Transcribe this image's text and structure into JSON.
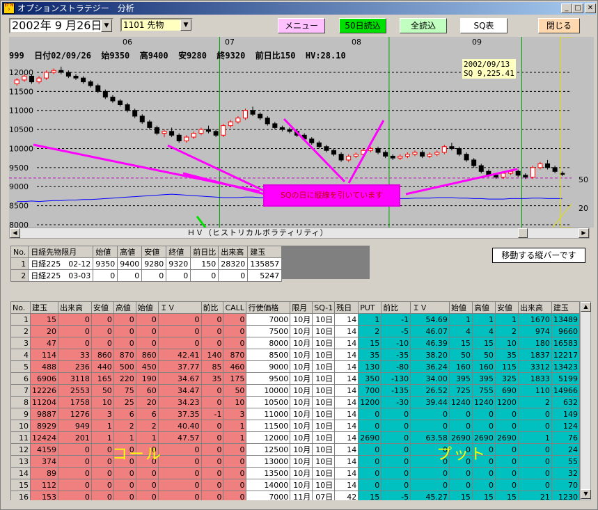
{
  "window": {
    "title": "オプションストラテジー　分析",
    "icon_text": "ｵﾌﾟｼｮﾝ",
    "min_label": "_",
    "max_label": "□",
    "close_label": "✕"
  },
  "toolbar": {
    "date": "2002年 9 月26日",
    "code": "1101 先物",
    "menu_label": "メニュー",
    "read50_label": "50日読込",
    "readall_label": "全読込",
    "sq_label": "SQ表",
    "close_label": "閉じる"
  },
  "chart": {
    "month_labels": [
      "06",
      "07",
      "08",
      "09"
    ],
    "info_line": "999  日付02/09/26  始9350  高9400  安9280  終9320  前日比150  HV:28.10",
    "sq_note_line1": "2002/09/13",
    "sq_note_line2": "SQ 9,225.41",
    "y_ticks": [
      "12000",
      "11500",
      "11000",
      "10500",
      "10000",
      "9500",
      "9000",
      "8500",
      "8000"
    ],
    "right_ticks": [
      "50",
      "20"
    ],
    "annotation": "SQの日に縦線を引いています",
    "hv_label": "ＨＶ（ヒストリカルボラティリティ）",
    "moving_bar_note": "移動する縦バーです",
    "colors": {
      "up": "#ff0000",
      "down": "#000000",
      "ma": "#0000ff",
      "sq_line": "#00a000",
      "annotation_bg": "#ff00ff",
      "annotation_arrow": "#ff00ff"
    }
  },
  "chart_data": {
    "type": "candlestick",
    "y_range": [
      8000,
      12200
    ],
    "hv_range": [
      0,
      100
    ],
    "sq_days": [
      28,
      51,
      69,
      93
    ],
    "candles": [
      [
        11700,
        11850,
        11650,
        11800
      ],
      [
        11800,
        11950,
        11750,
        11900
      ],
      [
        11900,
        11950,
        11700,
        11750
      ],
      [
        11750,
        11900,
        11700,
        11850
      ],
      [
        11850,
        12050,
        11800,
        12000
      ],
      [
        12000,
        12100,
        11950,
        12050
      ],
      [
        12050,
        12150,
        11950,
        12000
      ],
      [
        12000,
        12050,
        11850,
        11900
      ],
      [
        11900,
        11950,
        11800,
        11850
      ],
      [
        11850,
        11900,
        11700,
        11750
      ],
      [
        11750,
        11800,
        11600,
        11650
      ],
      [
        11650,
        11700,
        11450,
        11500
      ],
      [
        11500,
        11550,
        11300,
        11350
      ],
      [
        11350,
        11400,
        11200,
        11250
      ],
      [
        11250,
        11300,
        11100,
        11150
      ],
      [
        11150,
        11200,
        10950,
        11000
      ],
      [
        11000,
        11050,
        10800,
        10850
      ],
      [
        10850,
        10900,
        10650,
        10700
      ],
      [
        10700,
        10750,
        10500,
        10550
      ],
      [
        10550,
        10600,
        10350,
        10400
      ],
      [
        10400,
        10500,
        10300,
        10450
      ],
      [
        10450,
        10550,
        10300,
        10350
      ],
      [
        10350,
        10400,
        10150,
        10200
      ],
      [
        10200,
        10350,
        10150,
        10300
      ],
      [
        10300,
        10450,
        10250,
        10400
      ],
      [
        10400,
        10550,
        10350,
        10500
      ],
      [
        10500,
        10600,
        10400,
        10450
      ],
      [
        10450,
        10500,
        10300,
        10350
      ],
      [
        10350,
        10650,
        10300,
        10600
      ],
      [
        10600,
        10750,
        10550,
        10700
      ],
      [
        10700,
        10850,
        10650,
        10800
      ],
      [
        10800,
        11050,
        10750,
        11000
      ],
      [
        11000,
        11100,
        10850,
        10900
      ],
      [
        10900,
        10950,
        10750,
        10800
      ],
      [
        10800,
        10850,
        10600,
        10650
      ],
      [
        10650,
        10700,
        10500,
        10550
      ],
      [
        10550,
        10600,
        10450,
        10500
      ],
      [
        10500,
        10550,
        10400,
        10450
      ],
      [
        10450,
        10500,
        10300,
        10350
      ],
      [
        10350,
        10400,
        10200,
        10250
      ],
      [
        10250,
        10300,
        10100,
        10150
      ],
      [
        10150,
        10200,
        10000,
        10050
      ],
      [
        10050,
        10100,
        9900,
        9950
      ],
      [
        9950,
        10000,
        9800,
        9850
      ],
      [
        9850,
        9900,
        9650,
        9700
      ],
      [
        9700,
        9850,
        9650,
        9800
      ],
      [
        9800,
        9900,
        9750,
        9850
      ],
      [
        9850,
        10000,
        9800,
        9950
      ],
      [
        9950,
        10050,
        9900,
        10000
      ],
      [
        10000,
        10050,
        9850,
        9900
      ],
      [
        9900,
        9950,
        9750,
        9800
      ],
      [
        9800,
        9850,
        9700,
        9750
      ],
      [
        9750,
        9850,
        9700,
        9800
      ],
      [
        9800,
        9900,
        9750,
        9850
      ],
      [
        9850,
        9950,
        9800,
        9900
      ],
      [
        9900,
        9950,
        9750,
        9800
      ],
      [
        9800,
        9900,
        9750,
        9850
      ],
      [
        9850,
        9950,
        9800,
        9900
      ],
      [
        9900,
        10100,
        9850,
        10050
      ],
      [
        10050,
        10150,
        9950,
        10000
      ],
      [
        10000,
        10050,
        9800,
        9850
      ],
      [
        9850,
        9900,
        9650,
        9700
      ],
      [
        9700,
        9750,
        9500,
        9550
      ],
      [
        9550,
        9600,
        9350,
        9400
      ],
      [
        9400,
        9450,
        9250,
        9300
      ],
      [
        9300,
        9350,
        9200,
        9250
      ],
      [
        9250,
        9400,
        9200,
        9350
      ],
      [
        9350,
        9450,
        9300,
        9400
      ],
      [
        9400,
        9450,
        9250,
        9300
      ],
      [
        9300,
        9350,
        9200,
        9250
      ],
      [
        9250,
        9550,
        9200,
        9500
      ],
      [
        9500,
        9650,
        9450,
        9600
      ],
      [
        9600,
        9700,
        9450,
        9500
      ],
      [
        9500,
        9550,
        9350,
        9400
      ],
      [
        9350,
        9400,
        9280,
        9320
      ]
    ],
    "hv_series": [
      22,
      22,
      23,
      22,
      23,
      24,
      24,
      25,
      25,
      26,
      26,
      27,
      28,
      29,
      30,
      31,
      32,
      33,
      34,
      35,
      36,
      37,
      36,
      35,
      34,
      33,
      32,
      31,
      30,
      30,
      30,
      31,
      31,
      30,
      30,
      29,
      29,
      29,
      28,
      28,
      27,
      27,
      26,
      26,
      25,
      25,
      25,
      26,
      26,
      27,
      27,
      28,
      28,
      28,
      29,
      29,
      29,
      30,
      30,
      30,
      29,
      29,
      28,
      28,
      27,
      27,
      27,
      28,
      28,
      28,
      29,
      29,
      28,
      28,
      28
    ]
  },
  "futures": {
    "headers": [
      "No.",
      "日経先物限月",
      "始値",
      "高値",
      "安値",
      "終値",
      "前日比",
      "出来高",
      "建玉"
    ],
    "rows": [
      [
        "1",
        "日経225　02-12",
        "9350",
        "9400",
        "9280",
        "9320",
        "150",
        "28320",
        "135857"
      ],
      [
        "2",
        "日経225　03-03",
        "0",
        "0",
        "0",
        "0",
        "0",
        "0",
        "5247"
      ]
    ]
  },
  "options": {
    "headers": [
      "No.",
      "建玉",
      "出来高",
      "安値",
      "高値",
      "始値",
      "ＩＶ",
      "前比",
      "CALL",
      "行使価格",
      "限月",
      "SQ-1",
      "残日",
      "PUT",
      "前比",
      "ＩＶ",
      "始値",
      "高値",
      "安値",
      "出来高",
      "建玉"
    ],
    "rows": [
      [
        "1",
        "15",
        "0",
        "0",
        "0",
        "0",
        "0",
        "0",
        "0",
        "7000",
        "10月",
        "10日",
        "14",
        "1",
        "-1",
        "54.69",
        "1",
        "1",
        "1",
        "1670",
        "13489"
      ],
      [
        "2",
        "20",
        "0",
        "0",
        "0",
        "0",
        "0",
        "0",
        "0",
        "7500",
        "10月",
        "10日",
        "14",
        "2",
        "-5",
        "46.07",
        "4",
        "4",
        "2",
        "974",
        "9660"
      ],
      [
        "3",
        "47",
        "0",
        "0",
        "0",
        "0",
        "0",
        "0",
        "0",
        "8000",
        "10月",
        "10日",
        "14",
        "15",
        "-10",
        "46.39",
        "15",
        "15",
        "10",
        "180",
        "16583"
      ],
      [
        "4",
        "114",
        "33",
        "860",
        "870",
        "860",
        "42.41",
        "140",
        "870",
        "8500",
        "10月",
        "10日",
        "14",
        "35",
        "-35",
        "38.20",
        "50",
        "50",
        "35",
        "1837",
        "12217"
      ],
      [
        "5",
        "488",
        "236",
        "440",
        "500",
        "450",
        "37.77",
        "85",
        "460",
        "9000",
        "10月",
        "10日",
        "14",
        "130",
        "-80",
        "36.24",
        "160",
        "160",
        "115",
        "3312",
        "13423"
      ],
      [
        "6",
        "6906",
        "3118",
        "165",
        "220",
        "190",
        "34.67",
        "35",
        "175",
        "9500",
        "10月",
        "10日",
        "14",
        "350",
        "-130",
        "34.00",
        "395",
        "395",
        "325",
        "1833",
        "5199"
      ],
      [
        "7",
        "12226",
        "2553",
        "50",
        "75",
        "60",
        "34.47",
        "0",
        "50",
        "10000",
        "10月",
        "10日",
        "14",
        "700",
        "-135",
        "26.52",
        "725",
        "755",
        "690",
        "110",
        "14966"
      ],
      [
        "8",
        "11204",
        "1758",
        "10",
        "25",
        "20",
        "34.23",
        "0",
        "10",
        "10500",
        "10月",
        "10日",
        "14",
        "1200",
        "-30",
        "39.44",
        "1240",
        "1240",
        "1200",
        "2",
        "632"
      ],
      [
        "9",
        "9887",
        "1276",
        "3",
        "6",
        "6",
        "37.35",
        "-1",
        "3",
        "11000",
        "10月",
        "10日",
        "14",
        "0",
        "0",
        "0",
        "0",
        "0",
        "0",
        "0",
        "149"
      ],
      [
        "10",
        "8929",
        "949",
        "1",
        "2",
        "2",
        "40.40",
        "0",
        "1",
        "11500",
        "10月",
        "10日",
        "14",
        "0",
        "0",
        "0",
        "0",
        "0",
        "0",
        "0",
        "124"
      ],
      [
        "11",
        "12424",
        "201",
        "1",
        "1",
        "1",
        "47.57",
        "0",
        "1",
        "12000",
        "10月",
        "10日",
        "14",
        "2690",
        "0",
        "63.58",
        "2690",
        "2690",
        "2690",
        "1",
        "76"
      ],
      [
        "12",
        "4159",
        "0",
        "0",
        "0",
        "0",
        "0",
        "0",
        "0",
        "12500",
        "10月",
        "10日",
        "14",
        "0",
        "0",
        "0",
        "0",
        "0",
        "0",
        "0",
        "24"
      ],
      [
        "13",
        "374",
        "0",
        "0",
        "0",
        "0",
        "0",
        "0",
        "0",
        "13000",
        "10月",
        "10日",
        "14",
        "0",
        "0",
        "0",
        "0",
        "0",
        "0",
        "0",
        "55"
      ],
      [
        "14",
        "89",
        "0",
        "0",
        "0",
        "0",
        "0",
        "0",
        "0",
        "13500",
        "10月",
        "10日",
        "14",
        "0",
        "0",
        "0",
        "0",
        "0",
        "0",
        "0",
        "32"
      ],
      [
        "15",
        "112",
        "0",
        "0",
        "0",
        "0",
        "0",
        "0",
        "0",
        "14000",
        "10月",
        "10日",
        "14",
        "0",
        "0",
        "0",
        "0",
        "0",
        "0",
        "0",
        "70"
      ],
      [
        "16",
        "153",
        "0",
        "0",
        "0",
        "0",
        "0",
        "0",
        "0",
        "7000",
        "11月",
        "07日",
        "42",
        "15",
        "-5",
        "45.27",
        "15",
        "15",
        "15",
        "21",
        "1230"
      ]
    ],
    "call_watermark": "コール",
    "put_watermark": "プット"
  }
}
